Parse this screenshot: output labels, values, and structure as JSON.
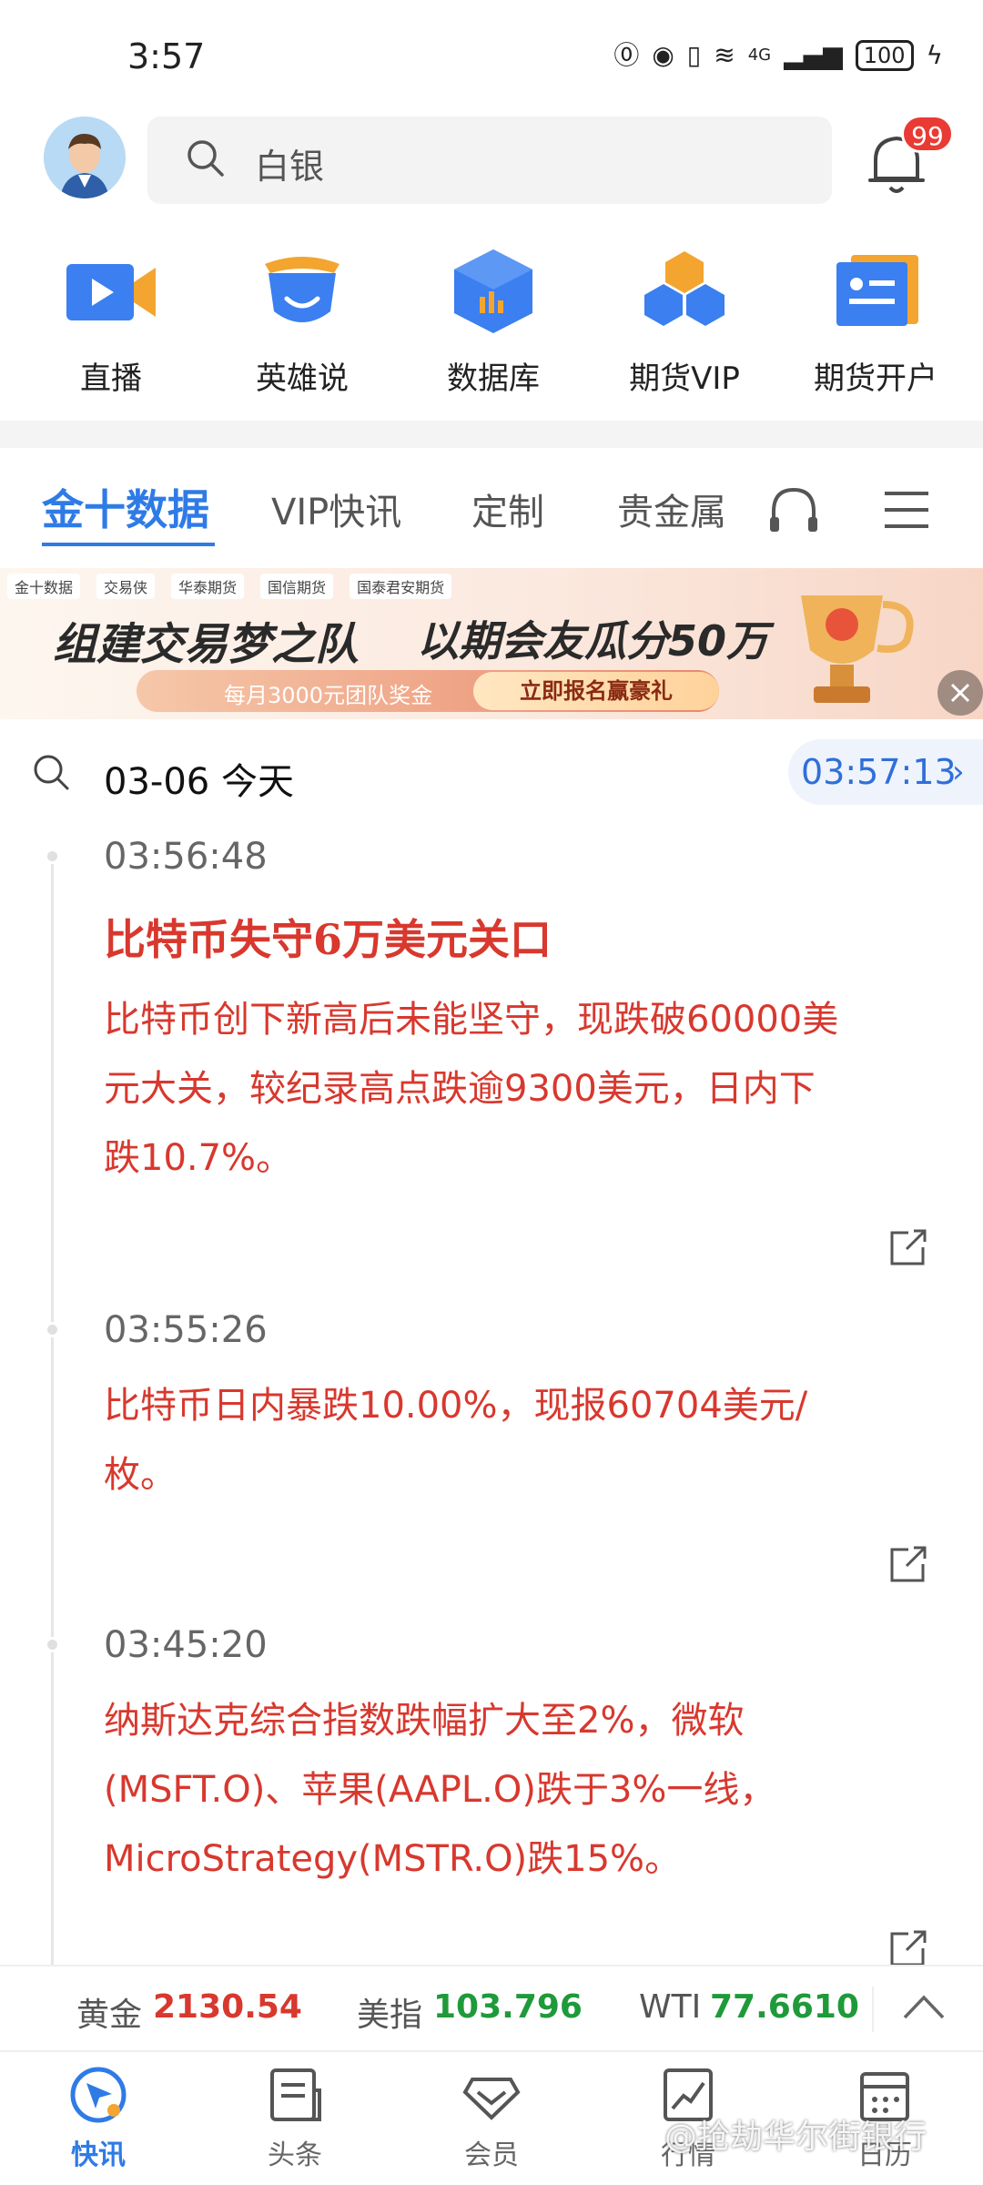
{
  "status_bar": {
    "time": "3:57",
    "network": "4G",
    "battery": "100"
  },
  "header": {
    "search_placeholder": "白银",
    "notification_badge": "99"
  },
  "quick_entries": [
    {
      "label": "直播",
      "icon": "live-video-icon"
    },
    {
      "label": "英雄说",
      "icon": "hero-mask-icon"
    },
    {
      "label": "数据库",
      "icon": "database-cube-icon"
    },
    {
      "label": "期货VIP",
      "icon": "futures-vip-cubes-icon"
    },
    {
      "label": "期货开户",
      "icon": "futures-account-card-icon"
    }
  ],
  "tabs": [
    {
      "label": "金十数据",
      "active": true
    },
    {
      "label": "VIP快讯",
      "active": false
    },
    {
      "label": "定制",
      "active": false
    },
    {
      "label": "贵金属",
      "active": false
    }
  ],
  "banner": {
    "logos": [
      "金十数据",
      "交易侠",
      "华泰期货",
      "国信期货",
      "国泰君安期货"
    ],
    "title_left": "组建交易梦之队",
    "title_right": "以期会友瓜分50万",
    "subtitle": "每月3000元团队奖金",
    "cta": "立即报名赢豪礼"
  },
  "date_bar": {
    "date": "03-06 今天",
    "clock": "03:57:13"
  },
  "news": [
    {
      "time": "03:56:48",
      "title": "比特币失守6万美元关口",
      "body_lines": [
        "比特币创下新高后未能坚守，现跌破60000美",
        "元大关，较纪录高点跌逾9300美元，日内下",
        "跌10.7%。"
      ]
    },
    {
      "time": "03:55:26",
      "title": "",
      "body_lines": [
        "比特币日内暴跌10.00%，现报60704美元/",
        "枚。"
      ]
    },
    {
      "time": "03:45:20",
      "title": "",
      "body_lines": [
        "纳斯达克综合指数跌幅扩大至2%，微软",
        "(MSFT.O)、苹果(AAPL.O)跌于3%一线，",
        "MicroStrategy(MSTR.O)跌15%。"
      ]
    }
  ],
  "ticker": [
    {
      "label": "黄金",
      "value": "2130.54",
      "color": "#d8382e"
    },
    {
      "label": "美指",
      "value": "103.796",
      "color": "#1f9a3a"
    },
    {
      "label": "WTI",
      "value": "77.6610",
      "color": "#1f9a3a"
    }
  ],
  "bottom_nav": [
    {
      "label": "快讯",
      "active": true
    },
    {
      "label": "头条",
      "active": false
    },
    {
      "label": "会员",
      "active": false
    },
    {
      "label": "行情",
      "active": false
    },
    {
      "label": "日历",
      "active": false
    }
  ],
  "watermark": "@抢劫华尔街银行",
  "colors": {
    "accent": "#2f7be6",
    "news_red": "#d8382e",
    "up_green": "#1f9a3a"
  }
}
